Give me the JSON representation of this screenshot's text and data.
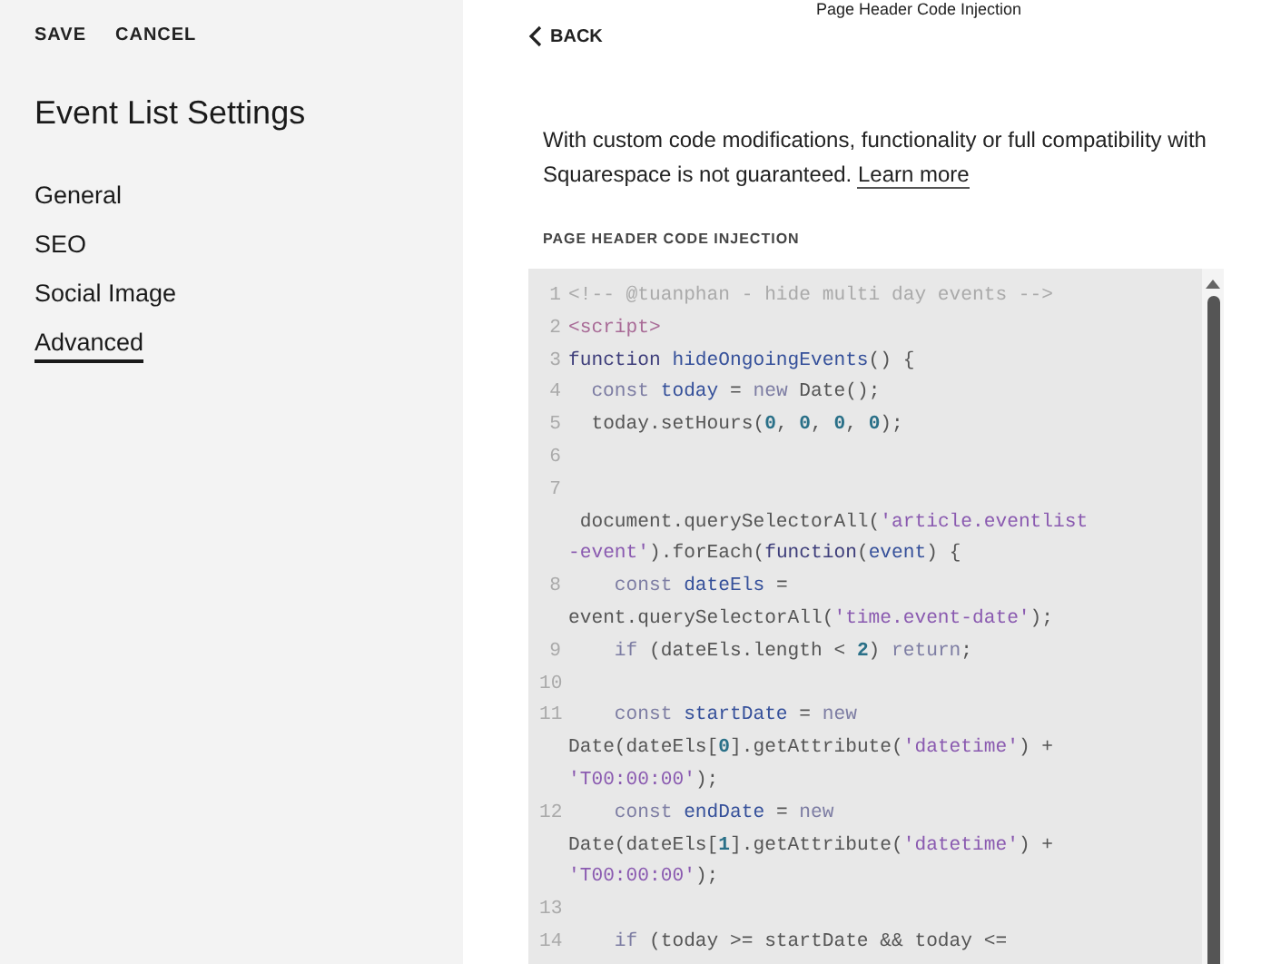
{
  "sidebar": {
    "actions": [
      "SAVE",
      "CANCEL"
    ],
    "title": "Event List Settings",
    "items": [
      {
        "label": "General",
        "selected": false
      },
      {
        "label": "SEO",
        "selected": false
      },
      {
        "label": "Social Image",
        "selected": false
      },
      {
        "label": "Advanced",
        "selected": true
      }
    ]
  },
  "panel": {
    "title": "Page Header Code Injection",
    "back": "BACK",
    "notice": "With custom code modifications, functionality or full compatibility with Squarespace is not guaranteed.",
    "notice_link": "Learn more",
    "field_label": "PAGE HEADER CODE INJECTION",
    "code_lines": [
      {
        "number": "1",
        "tokens": [
          {
            "kind": "comment",
            "text": "<!-- @tuanphan - hide multi day events -->"
          }
        ]
      },
      {
        "number": "2",
        "tokens": [
          {
            "kind": "tag",
            "text": "<script>"
          }
        ]
      },
      {
        "number": "3",
        "tokens": [
          {
            "kind": "kw",
            "text": "function "
          },
          {
            "kind": "def",
            "text": "hideOngoingEvents"
          },
          {
            "kind": "plain",
            "text": "() {"
          }
        ]
      },
      {
        "number": "4",
        "tokens": [
          {
            "kind": "indent1"
          },
          {
            "kind": "kw2",
            "text": "const "
          },
          {
            "kind": "def",
            "text": "today"
          },
          {
            "kind": "plain",
            "text": " = "
          },
          {
            "kind": "kw2",
            "text": "new "
          },
          {
            "kind": "plain",
            "text": "Date();"
          }
        ]
      },
      {
        "number": "5",
        "tokens": [
          {
            "kind": "plain",
            "text": "  today.setHours("
          },
          {
            "kind": "num",
            "text": "0"
          },
          {
            "kind": "plain",
            "text": ", "
          },
          {
            "kind": "num",
            "text": "0"
          },
          {
            "kind": "plain",
            "text": ", "
          },
          {
            "kind": "num",
            "text": "0"
          },
          {
            "kind": "plain",
            "text": ", "
          },
          {
            "kind": "num",
            "text": "0"
          },
          {
            "kind": "plain",
            "text": ");"
          }
        ]
      },
      {
        "number": "6"
      },
      {
        "number": "7",
        "tokens": [
          {
            "kind": "br"
          },
          {
            "kind": "plain",
            "text": " document.querySelectorAll("
          },
          {
            "kind": "str",
            "text": "'article.eventlist"
          },
          {
            "kind": "br"
          },
          {
            "kind": "str",
            "text": "-event'"
          },
          {
            "kind": "plain",
            "text": ").forEach("
          },
          {
            "kind": "kw",
            "text": "function"
          },
          {
            "kind": "plain",
            "text": "("
          },
          {
            "kind": "def",
            "text": "event"
          },
          {
            "kind": "plain",
            "text": ") {"
          }
        ]
      },
      {
        "number": "8",
        "tokens": [
          {
            "kind": "indent2"
          },
          {
            "kind": "kw2",
            "text": "const "
          },
          {
            "kind": "def",
            "text": "dateEls"
          },
          {
            "kind": "plain",
            "text": " ="
          },
          {
            "kind": "br"
          },
          {
            "kind": "plain",
            "text": "event.querySelectorAll("
          },
          {
            "kind": "str",
            "text": "'time.event-date'"
          },
          {
            "kind": "plain",
            "text": ");"
          }
        ]
      },
      {
        "number": "9",
        "tokens": [
          {
            "kind": "indent2"
          },
          {
            "kind": "kw2",
            "text": "if "
          },
          {
            "kind": "plain",
            "text": "(dateEls.length < "
          },
          {
            "kind": "num",
            "text": "2"
          },
          {
            "kind": "plain",
            "text": ") "
          },
          {
            "kind": "kw2",
            "text": "return"
          },
          {
            "kind": "plain",
            "text": ";"
          }
        ]
      },
      {
        "number": "10"
      },
      {
        "number": "11",
        "tokens": [
          {
            "kind": "indent2"
          },
          {
            "kind": "kw2",
            "text": "const "
          },
          {
            "kind": "def",
            "text": "startDate"
          },
          {
            "kind": "plain",
            "text": " = "
          },
          {
            "kind": "kw2",
            "text": "new"
          },
          {
            "kind": "br"
          },
          {
            "kind": "plain",
            "text": "Date(dateEls["
          },
          {
            "kind": "num",
            "text": "0"
          },
          {
            "kind": "plain",
            "text": "].getAttribute("
          },
          {
            "kind": "str",
            "text": "'datetime'"
          },
          {
            "kind": "plain",
            "text": ") +"
          },
          {
            "kind": "br"
          },
          {
            "kind": "str",
            "text": "'T00:00:00'"
          },
          {
            "kind": "plain",
            "text": ");"
          }
        ]
      },
      {
        "number": "12",
        "tokens": [
          {
            "kind": "indent2"
          },
          {
            "kind": "kw2",
            "text": "const "
          },
          {
            "kind": "def",
            "text": "endDate"
          },
          {
            "kind": "plain",
            "text": " = "
          },
          {
            "kind": "kw2",
            "text": "new"
          },
          {
            "kind": "br"
          },
          {
            "kind": "plain",
            "text": "Date(dateEls["
          },
          {
            "kind": "num",
            "text": "1"
          },
          {
            "kind": "plain",
            "text": "].getAttribute("
          },
          {
            "kind": "str",
            "text": "'datetime'"
          },
          {
            "kind": "plain",
            "text": ") +"
          },
          {
            "kind": "br"
          },
          {
            "kind": "str",
            "text": "'T00:00:00'"
          },
          {
            "kind": "plain",
            "text": ");"
          }
        ]
      },
      {
        "number": "13"
      },
      {
        "number": "14",
        "tokens": [
          {
            "kind": "indent2"
          },
          {
            "kind": "kw2",
            "text": "if "
          },
          {
            "kind": "plain",
            "text": "(today >= startDate && today <="
          }
        ]
      }
    ]
  }
}
